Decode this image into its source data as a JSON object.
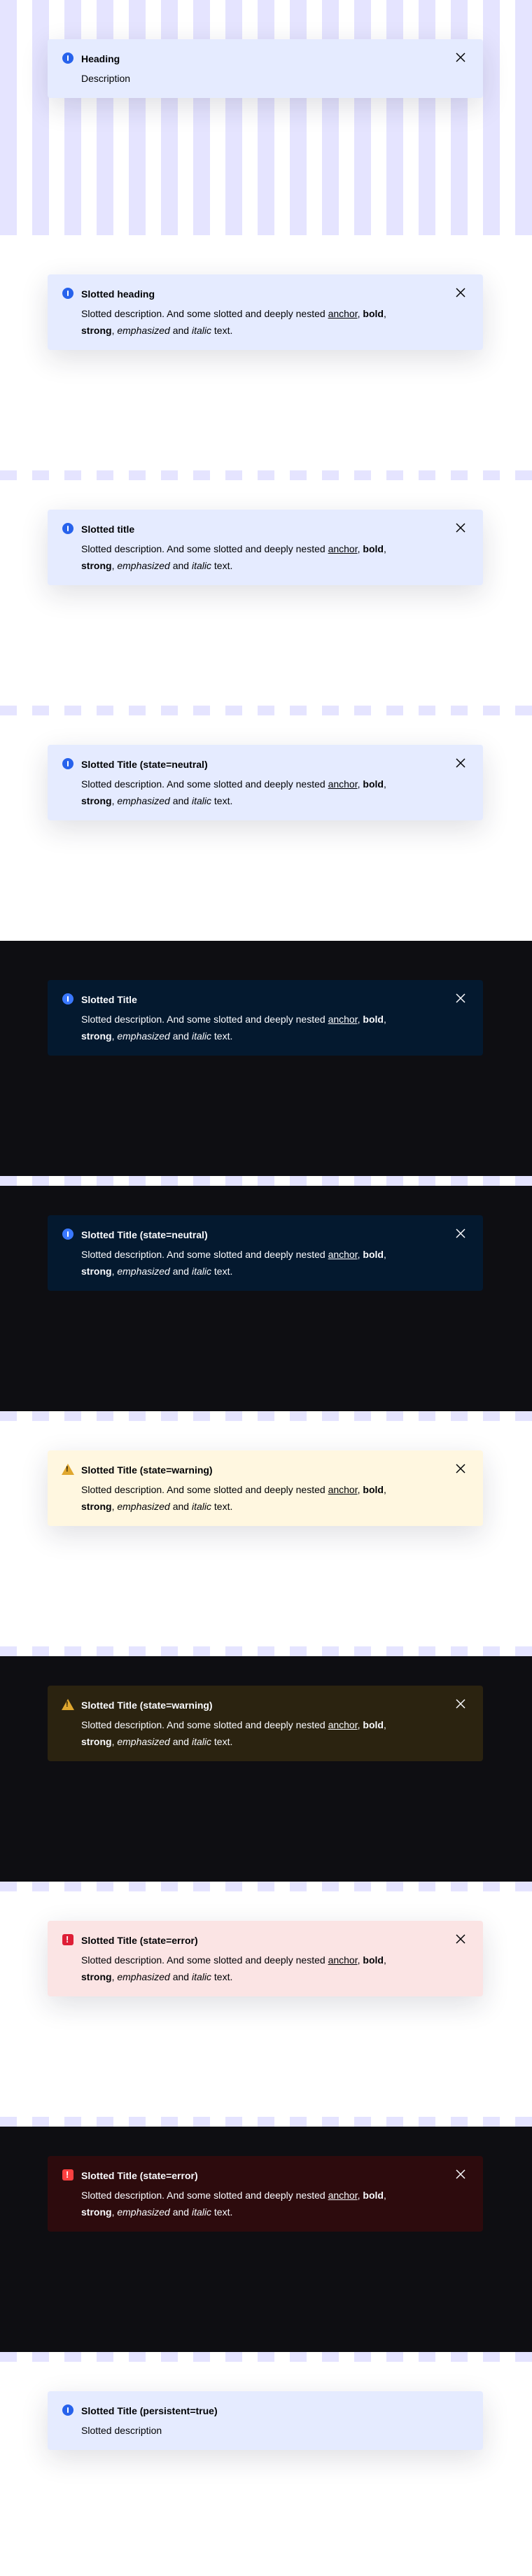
{
  "banners": [
    {
      "title": "Heading",
      "description": "Description",
      "state": "info",
      "theme": "light"
    },
    {
      "title": "Slotted heading",
      "desc_prefix": "Slotted description. And some slotted and deeply nested ",
      "desc_anchor": "anchor",
      "desc_sep1": ", ",
      "desc_bold": "bold",
      "desc_sep2": ", ",
      "desc_strong": "strong",
      "desc_sep3": ", ",
      "desc_em": "emphasized",
      "desc_and": " and ",
      "desc_italic": "italic",
      "desc_suffix": " text.",
      "state": "info",
      "theme": "light"
    },
    {
      "title": "Slotted title",
      "state": "info",
      "theme": "light"
    },
    {
      "title": "Slotted Title (state=neutral)",
      "state": "neutral",
      "theme": "light"
    },
    {
      "title": "Slotted Title",
      "state": "info",
      "theme": "dark"
    },
    {
      "title": "Slotted Title (state=neutral)",
      "state": "neutral",
      "theme": "dark"
    },
    {
      "title": "Slotted Title (state=warning)",
      "state": "warning",
      "theme": "light"
    },
    {
      "title": "Slotted Title (state=warning)",
      "state": "warning",
      "theme": "dark"
    },
    {
      "title": "Slotted Title (state=error)",
      "state": "error",
      "theme": "light"
    },
    {
      "title": "Slotted Title (state=error)",
      "state": "error",
      "theme": "dark"
    },
    {
      "title": "Slotted Title (persistent=true)",
      "description": "Slotted description",
      "state": "info",
      "theme": "light"
    }
  ],
  "rich": {
    "prefix": "Slotted description. And some slotted and deeply nested ",
    "anchor": "anchor",
    "sep": ", ",
    "bold": "bold",
    "strong": "strong",
    "em": "emphasized",
    "and": " and ",
    "italic": "italic",
    "suffix": " text."
  },
  "icons": {
    "info": "information-icon",
    "warning": "warning-icon",
    "error": "error-icon",
    "close": "close-icon"
  },
  "colors": {
    "info_bg_light": "#e5ebff",
    "info_bg_dark": "#04192f",
    "warning_bg_light": "#fff7e0",
    "warning_bg_dark": "#2b2310",
    "error_bg_light": "#fbe4e4",
    "error_bg_dark": "#2d0b0d",
    "stripe": "#e5e4ff",
    "dark_canvas": "#0e0e12"
  }
}
